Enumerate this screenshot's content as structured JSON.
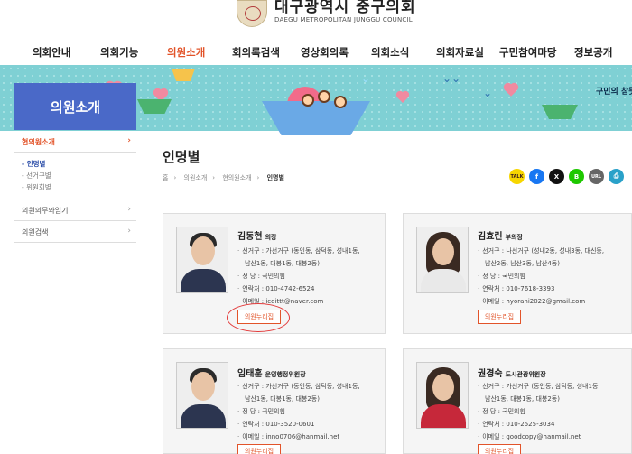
{
  "header": {
    "title": "대구광역시 중구의회",
    "subtitle": "DAEGU METROPOLITAN JUNGGU COUNCIL",
    "seal_text": "의회"
  },
  "gnb": [
    {
      "label": "의회안내"
    },
    {
      "label": "의회기능"
    },
    {
      "label": "의원소개",
      "active": true
    },
    {
      "label": "회의록검색"
    },
    {
      "label": "영상회의록"
    },
    {
      "label": "의회소식"
    },
    {
      "label": "의회자료실"
    },
    {
      "label": "구민참여마당"
    },
    {
      "label": "정보공개"
    }
  ],
  "banner": {
    "section_title": "의원소개",
    "slogan": "구민의 참뜻"
  },
  "sidebar": {
    "items": [
      {
        "label": "현의원소개",
        "active": true
      },
      {
        "label": "의원의무와임기"
      },
      {
        "label": "의원검색"
      }
    ],
    "sub": [
      {
        "label": "인명별",
        "active": true
      },
      {
        "label": "선거구별"
      },
      {
        "label": "위원회별"
      }
    ]
  },
  "content": {
    "title": "인명별",
    "breadcrumb": [
      "홈",
      "의원소개",
      "현의원소개",
      "인명별"
    ],
    "sns": [
      {
        "label": "TALK",
        "color": "#f7d600"
      },
      {
        "label": "f",
        "color": "#1877f2"
      },
      {
        "label": "X",
        "color": "#111111"
      },
      {
        "label": "B",
        "color": "#1ec800"
      },
      {
        "label": "URL",
        "color": "#666666"
      },
      {
        "label": "⎙",
        "color": "#2aa1c9"
      }
    ]
  },
  "members": [
    {
      "name": "김동현",
      "role": "의장",
      "district": "선거구 : 가선거구  (동인동, 삼덕동, 성내1동,",
      "district_cont": "남산1동, 대봉1동, 대봉2동)",
      "party": "정 당 : 국민의힘",
      "phone": "연락처 : 010-4742-6524",
      "email": "이메일 : icdittt@naver.com",
      "button": "의원누리집"
    },
    {
      "name": "김효린",
      "role": "부의장",
      "district": "선거구 : 나선거구  (성내2동, 성내3동, 대신동,",
      "district_cont": "남산2동, 남산3동, 남산4동)",
      "party": "정 당 : 국민의힘",
      "phone": "연락처 : 010-7618-3393",
      "email": "이메일 : hyorani2022@gmail.com",
      "button": "의원누리집"
    },
    {
      "name": "임태훈",
      "role": "운영행정위원장",
      "district": "선거구 : 가선거구  (동인동, 삼덕동, 성내1동,",
      "district_cont": "남산1동, 대봉1동, 대봉2동)",
      "party": "정 당 : 국민의힘",
      "phone": "연락처 : 010-3520-0601",
      "email": "이메일 : inno0706@hanmail.net",
      "button": "의원누리집"
    },
    {
      "name": "권경숙",
      "role": "도시관광위원장",
      "district": "선거구 : 가선거구  (동인동, 삼덕동, 성내1동,",
      "district_cont": "남산1동, 대봉1동, 대봉2동)",
      "party": "정 당 : 국민의힘",
      "phone": "연락처 : 010-2525-3034",
      "email": "이메일 : goodcopy@hanmail.net",
      "button": "의원누리집"
    }
  ]
}
